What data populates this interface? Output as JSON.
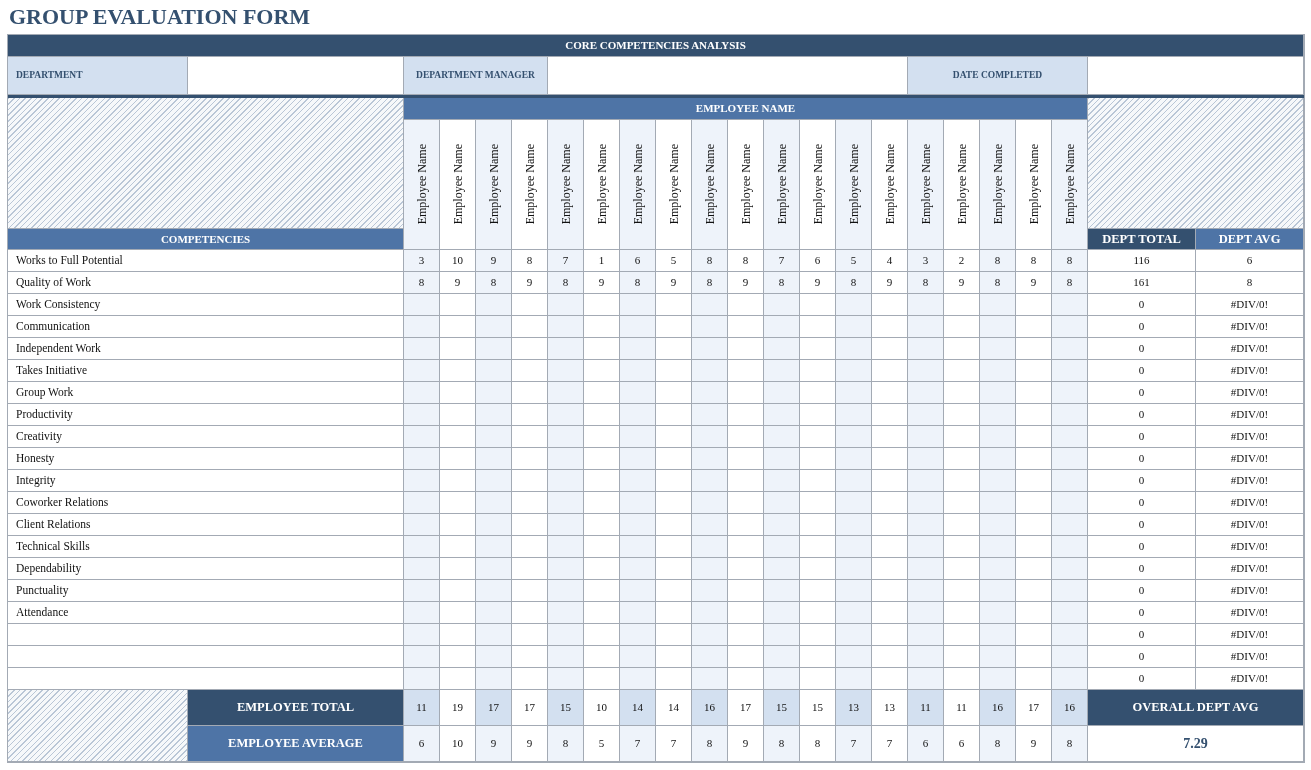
{
  "title": "GROUP EVALUATION FORM",
  "core_header": "CORE COMPETENCIES ANALYSIS",
  "fields": [
    {
      "label": "DEPARTMENT"
    },
    {
      "label": "DEPARTMENT MANAGER"
    },
    {
      "label": "DATE COMPLETED"
    }
  ],
  "employee_header": "EMPLOYEE NAME",
  "employees": [
    "Employee Name",
    "Employee Name",
    "Employee Name",
    "Employee Name",
    "Employee Name",
    "Employee Name",
    "Employee Name",
    "Employee Name",
    "Employee Name",
    "Employee Name",
    "Employee Name",
    "Employee Name",
    "Employee Name",
    "Employee Name",
    "Employee Name",
    "Employee Name",
    "Employee Name",
    "Employee Name",
    "Employee Name"
  ],
  "competencies_header": "COMPETENCIES",
  "dept_total_header": "DEPT TOTAL",
  "dept_avg_header": "DEPT AVG",
  "rows": [
    {
      "competency": "Works to Full Potential",
      "scores": [
        "3",
        "10",
        "9",
        "8",
        "7",
        "1",
        "6",
        "5",
        "8",
        "8",
        "7",
        "6",
        "5",
        "4",
        "3",
        "2",
        "8",
        "8",
        "8"
      ],
      "dept_total": "116",
      "dept_avg": "6"
    },
    {
      "competency": "Quality of Work",
      "scores": [
        "8",
        "9",
        "8",
        "9",
        "8",
        "9",
        "8",
        "9",
        "8",
        "9",
        "8",
        "9",
        "8",
        "9",
        "8",
        "9",
        "8",
        "9",
        "8"
      ],
      "dept_total": "161",
      "dept_avg": "8"
    },
    {
      "competency": "Work Consistency",
      "dept_total": "0",
      "dept_avg": "#DIV/0!"
    },
    {
      "competency": "Communication",
      "dept_total": "0",
      "dept_avg": "#DIV/0!"
    },
    {
      "competency": "Independent Work",
      "dept_total": "0",
      "dept_avg": "#DIV/0!"
    },
    {
      "competency": "Takes Initiative",
      "dept_total": "0",
      "dept_avg": "#DIV/0!"
    },
    {
      "competency": "Group Work",
      "dept_total": "0",
      "dept_avg": "#DIV/0!"
    },
    {
      "competency": "Productivity",
      "dept_total": "0",
      "dept_avg": "#DIV/0!"
    },
    {
      "competency": "Creativity",
      "dept_total": "0",
      "dept_avg": "#DIV/0!"
    },
    {
      "competency": "Honesty",
      "dept_total": "0",
      "dept_avg": "#DIV/0!"
    },
    {
      "competency": "Integrity",
      "dept_total": "0",
      "dept_avg": "#DIV/0!"
    },
    {
      "competency": "Coworker Relations",
      "dept_total": "0",
      "dept_avg": "#DIV/0!"
    },
    {
      "competency": "Client Relations",
      "dept_total": "0",
      "dept_avg": "#DIV/0!"
    },
    {
      "competency": "Technical Skills",
      "dept_total": "0",
      "dept_avg": "#DIV/0!"
    },
    {
      "competency": "Dependability",
      "dept_total": "0",
      "dept_avg": "#DIV/0!"
    },
    {
      "competency": "Punctuality",
      "dept_total": "0",
      "dept_avg": "#DIV/0!"
    },
    {
      "competency": "Attendance",
      "dept_total": "0",
      "dept_avg": "#DIV/0!"
    },
    {
      "dept_total": "0",
      "dept_avg": "#DIV/0!"
    },
    {
      "dept_total": "0",
      "dept_avg": "#DIV/0!"
    },
    {
      "dept_total": "0",
      "dept_avg": "#DIV/0!"
    }
  ],
  "employee_total": {
    "label": "EMPLOYEE TOTAL",
    "values": [
      "11",
      "19",
      "17",
      "17",
      "15",
      "10",
      "14",
      "14",
      "16",
      "17",
      "15",
      "15",
      "13",
      "13",
      "11",
      "11",
      "16",
      "17",
      "16"
    ]
  },
  "employee_average": {
    "label": "EMPLOYEE AVERAGE",
    "values": [
      "6",
      "10",
      "9",
      "9",
      "8",
      "5",
      "7",
      "7",
      "8",
      "9",
      "8",
      "8",
      "7",
      "7",
      "6",
      "6",
      "8",
      "9",
      "8"
    ]
  },
  "overall": {
    "label": "OVERALL DEPT AVG",
    "value": "7.29"
  }
}
